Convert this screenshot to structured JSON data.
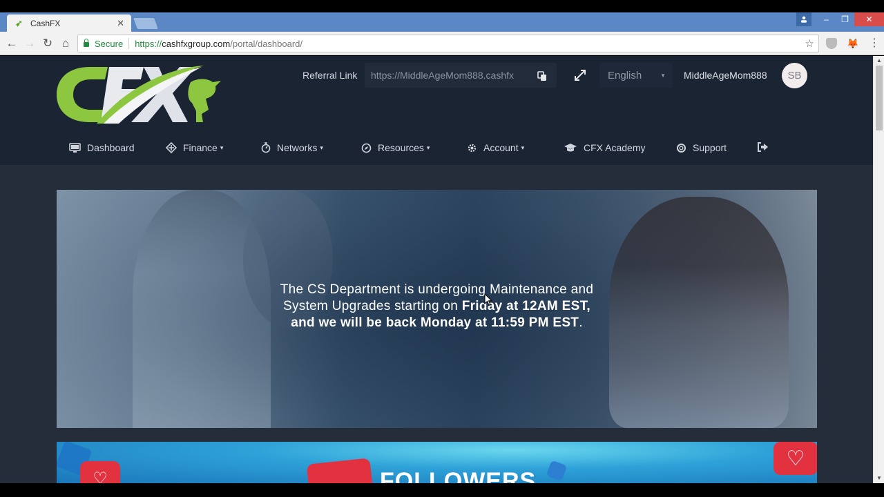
{
  "browser": {
    "tab_title": "CashFX",
    "security_label": "Secure",
    "url_scheme": "https://",
    "url_host": "cashfxgroup.com",
    "url_path": "/portal/dashboard/"
  },
  "header": {
    "logo_alt": "CFX",
    "referral_label": "Referral Link",
    "referral_value": "https://MiddleAgeMom888.cashfx",
    "language": "English",
    "username": "MiddleAgeMom888",
    "avatar_initials": "SB"
  },
  "nav": {
    "items": [
      {
        "label": "Dashboard",
        "icon": "monitor-icon",
        "dropdown": false
      },
      {
        "label": "Finance",
        "icon": "finance-icon",
        "dropdown": true
      },
      {
        "label": "Networks",
        "icon": "networks-icon",
        "dropdown": true
      },
      {
        "label": "Resources",
        "icon": "compass-icon",
        "dropdown": true
      },
      {
        "label": "Account",
        "icon": "gear-icon",
        "dropdown": true
      },
      {
        "label": "CFX Academy",
        "icon": "graduation-cap-icon",
        "dropdown": false
      },
      {
        "label": "Support",
        "icon": "lifebuoy-icon",
        "dropdown": false
      }
    ],
    "logout_icon": "logout-icon",
    "chevron": "⌄"
  },
  "hero": {
    "line1": "The CS Department is undergoing Maintenance and",
    "line2_regular": "System Upgrades starting on ",
    "line2_bold": "Friday at 12AM EST,",
    "line3_bold": "and we will be back Monday at 11:59 PM EST",
    "line3_end": "."
  },
  "promo": {
    "title": "FOLLOWERS"
  },
  "colors": {
    "header_bg": "#1b2433",
    "page_bg": "#252c3a",
    "brand_green": "#8dc63f",
    "tab_bar": "#5b87c5"
  }
}
